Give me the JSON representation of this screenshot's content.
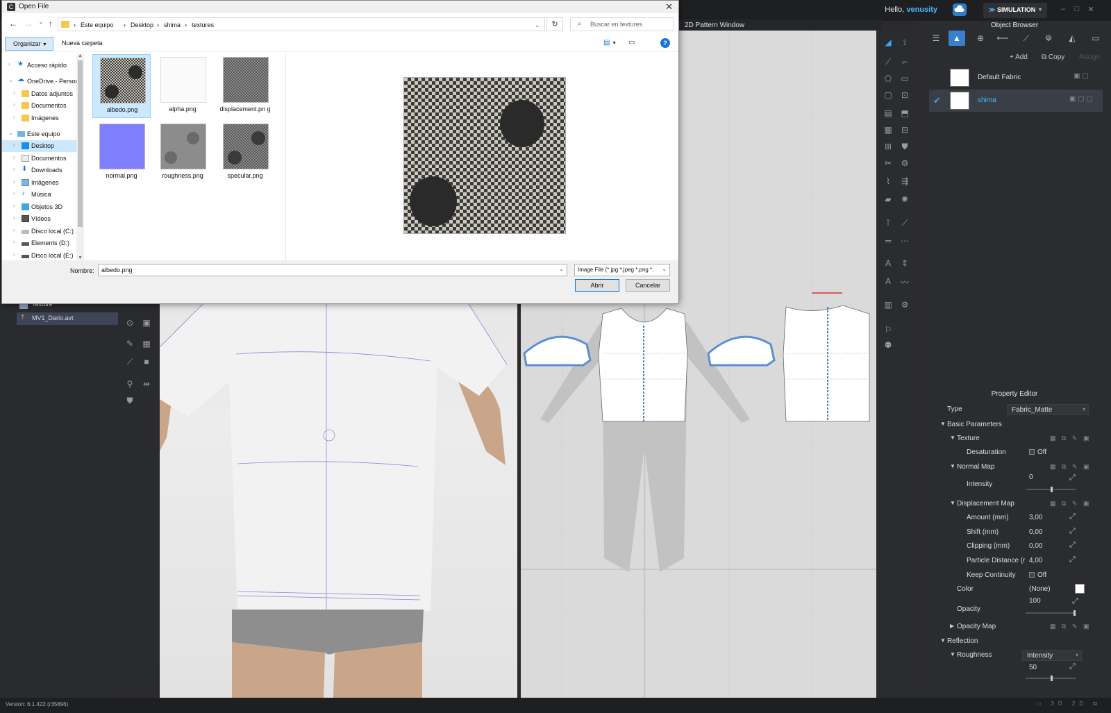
{
  "app": {
    "greeting_prefix": "Hello,",
    "username": "venusity",
    "mode_label": "SIMULATION",
    "version": "Version: 6.1.422 (r35896)"
  },
  "left_panel": {
    "items": [
      {
        "label": "Texture"
      },
      {
        "label": "MV1_Dario.avt"
      }
    ]
  },
  "pattern_window": {
    "title": "2D Pattern Window"
  },
  "object_browser": {
    "title": "Object Browser",
    "add_label": "Add",
    "copy_label": "Copy",
    "assign_label": "Assign",
    "fabrics": [
      {
        "name": "Default Fabric",
        "selected": false
      },
      {
        "name": "shima",
        "selected": true
      }
    ]
  },
  "property_editor": {
    "title": "Property Editor",
    "type_label": "Type",
    "type_value": "Fabric_Matte",
    "basic_parameters": "Basic Parameters",
    "texture": "Texture",
    "desaturation": {
      "label": "Desaturation",
      "value": "Off"
    },
    "normal_map": "Normal Map",
    "intensity": {
      "label": "Intensity",
      "value": "0"
    },
    "displacement_map": "Displacement Map",
    "amount": {
      "label": "Amount (mm)",
      "value": "3,00"
    },
    "shift": {
      "label": "Shift (mm)",
      "value": "0,00"
    },
    "clipping": {
      "label": "Clipping (mm)",
      "value": "0,00"
    },
    "particle_distance": {
      "label": "Particle Distance (r",
      "value": "4,00"
    },
    "keep_continuity": {
      "label": "Keep Continuity",
      "value": "Off"
    },
    "color": {
      "label": "Color",
      "value": "(None)",
      "swatch": "#ffffff"
    },
    "opacity": {
      "label": "Opacity",
      "value": "100"
    },
    "opacity_map": "Opacity Map",
    "reflection": "Reflection",
    "roughness": {
      "label": "Roughness",
      "mode": "Intensity",
      "value": "50"
    }
  },
  "dialog": {
    "title": "Open File",
    "breadcrumbs": [
      "Este equipo",
      "Desktop",
      "shima",
      "textures"
    ],
    "search_placeholder": "Buscar en textures",
    "organize_label": "Organizar",
    "new_folder_label": "Nueva carpeta",
    "nav_items": [
      {
        "label": "Acceso rápido",
        "icon": "star-icon",
        "level": 0
      },
      {
        "label": "OneDrive - Person",
        "icon": "cloud-icon",
        "level": 0
      },
      {
        "label": "Datos adjuntos",
        "icon": "folder-icon",
        "level": 1
      },
      {
        "label": "Documentos",
        "icon": "folder-icon",
        "level": 1
      },
      {
        "label": "Imágenes",
        "icon": "folder-icon",
        "level": 1
      },
      {
        "label": "Este equipo",
        "icon": "computer-icon",
        "level": 0
      },
      {
        "label": "Desktop",
        "icon": "desktop-folder-icon",
        "level": 1,
        "selected": true
      },
      {
        "label": "Documentos",
        "icon": "documents-icon",
        "level": 1
      },
      {
        "label": "Downloads",
        "icon": "download-icon",
        "level": 1
      },
      {
        "label": "Imágenes",
        "icon": "pictures-icon",
        "level": 1
      },
      {
        "label": "Música",
        "icon": "music-icon",
        "level": 1
      },
      {
        "label": "Objetos 3D",
        "icon": "3d-objects-icon",
        "level": 1
      },
      {
        "label": "Vídeos",
        "icon": "videos-icon",
        "level": 1
      },
      {
        "label": "Disco local (C:)",
        "icon": "drive-icon",
        "level": 1
      },
      {
        "label": "Elements (D:)",
        "icon": "drive-icon",
        "level": 1
      },
      {
        "label": "Disco local (E:)",
        "icon": "drive-icon",
        "level": 1
      }
    ],
    "files": [
      {
        "name": "albedo.png",
        "selected": true,
        "thumb": "albedo"
      },
      {
        "name": "alpha.png",
        "thumb": "alpha"
      },
      {
        "name": "displacement.pn g",
        "thumb": "displacement"
      },
      {
        "name": "normal.png",
        "thumb": "normal"
      },
      {
        "name": "roughness.png",
        "thumb": "roughness"
      },
      {
        "name": "specular.png",
        "thumb": "specular"
      }
    ],
    "filename_label": "Nombre:",
    "filename_value": "albedo.png",
    "filter_value": "Image File (*.jpg *.jpeg *.png *.",
    "open_label": "Abrir",
    "cancel_label": "Cancelar"
  },
  "colors": {
    "accent": "#3a7fc9",
    "selection_light": "#cce8ff",
    "app_bg": "#2b2b2d"
  }
}
